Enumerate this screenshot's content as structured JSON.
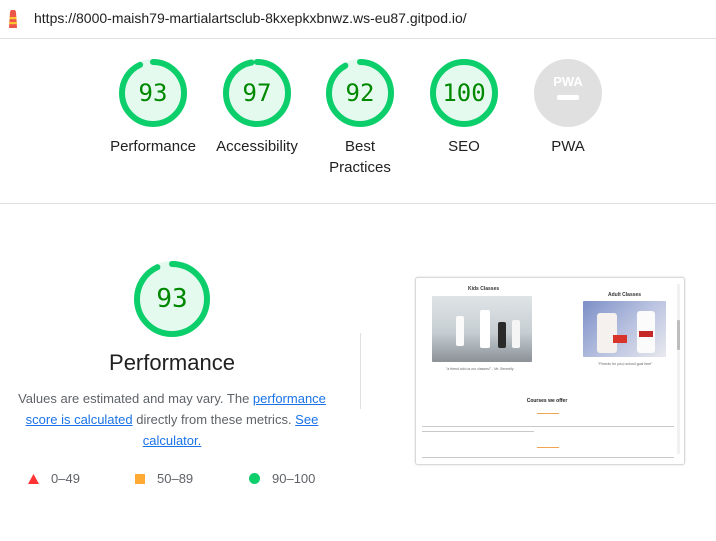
{
  "header": {
    "url": "https://8000-maish79-martialartsclub-8kxepkxbnwz.ws-eu87.gitpod.io/"
  },
  "scores": [
    {
      "label": "Performance",
      "value": "93",
      "fraction": 0.93,
      "status": "pass"
    },
    {
      "label": "Accessibility",
      "value": "97",
      "fraction": 0.97,
      "status": "pass"
    },
    {
      "label": "Best Practices",
      "value": "92",
      "fraction": 0.92,
      "status": "pass"
    },
    {
      "label": "SEO",
      "value": "100",
      "fraction": 1.0,
      "status": "pass"
    },
    {
      "label": "PWA",
      "value": "PWA",
      "status": "na"
    }
  ],
  "performance": {
    "score": "93",
    "fraction": 0.93,
    "title": "Performance",
    "desc_prefix": "Values are estimated and may vary. The ",
    "desc_link1": "performance score is calculated",
    "desc_middle": " directly from these metrics. ",
    "desc_link2": "See calculator."
  },
  "legend": [
    {
      "range": "0–49",
      "shape": "triangle",
      "color": "#ff3333"
    },
    {
      "range": "50–89",
      "shape": "square",
      "color": "#ffaa33"
    },
    {
      "range": "90–100",
      "shape": "circle",
      "color": "#0cce6b"
    }
  ],
  "screenshot": {
    "kids_title": "Kids Classes",
    "adult_title": "Adult Classes",
    "kids_caption": "\"a friend told us our classes!\" - Mr. Sennelly",
    "adult_caption": "\"Friends for you,t school goal here\"",
    "courses_heading": "Courses we offer"
  },
  "colors": {
    "pass": "#0cce6b",
    "pass_bg": "#e5faef",
    "pass_text": "#008800",
    "na": "#cccccc",
    "link": "#1a73e8"
  }
}
